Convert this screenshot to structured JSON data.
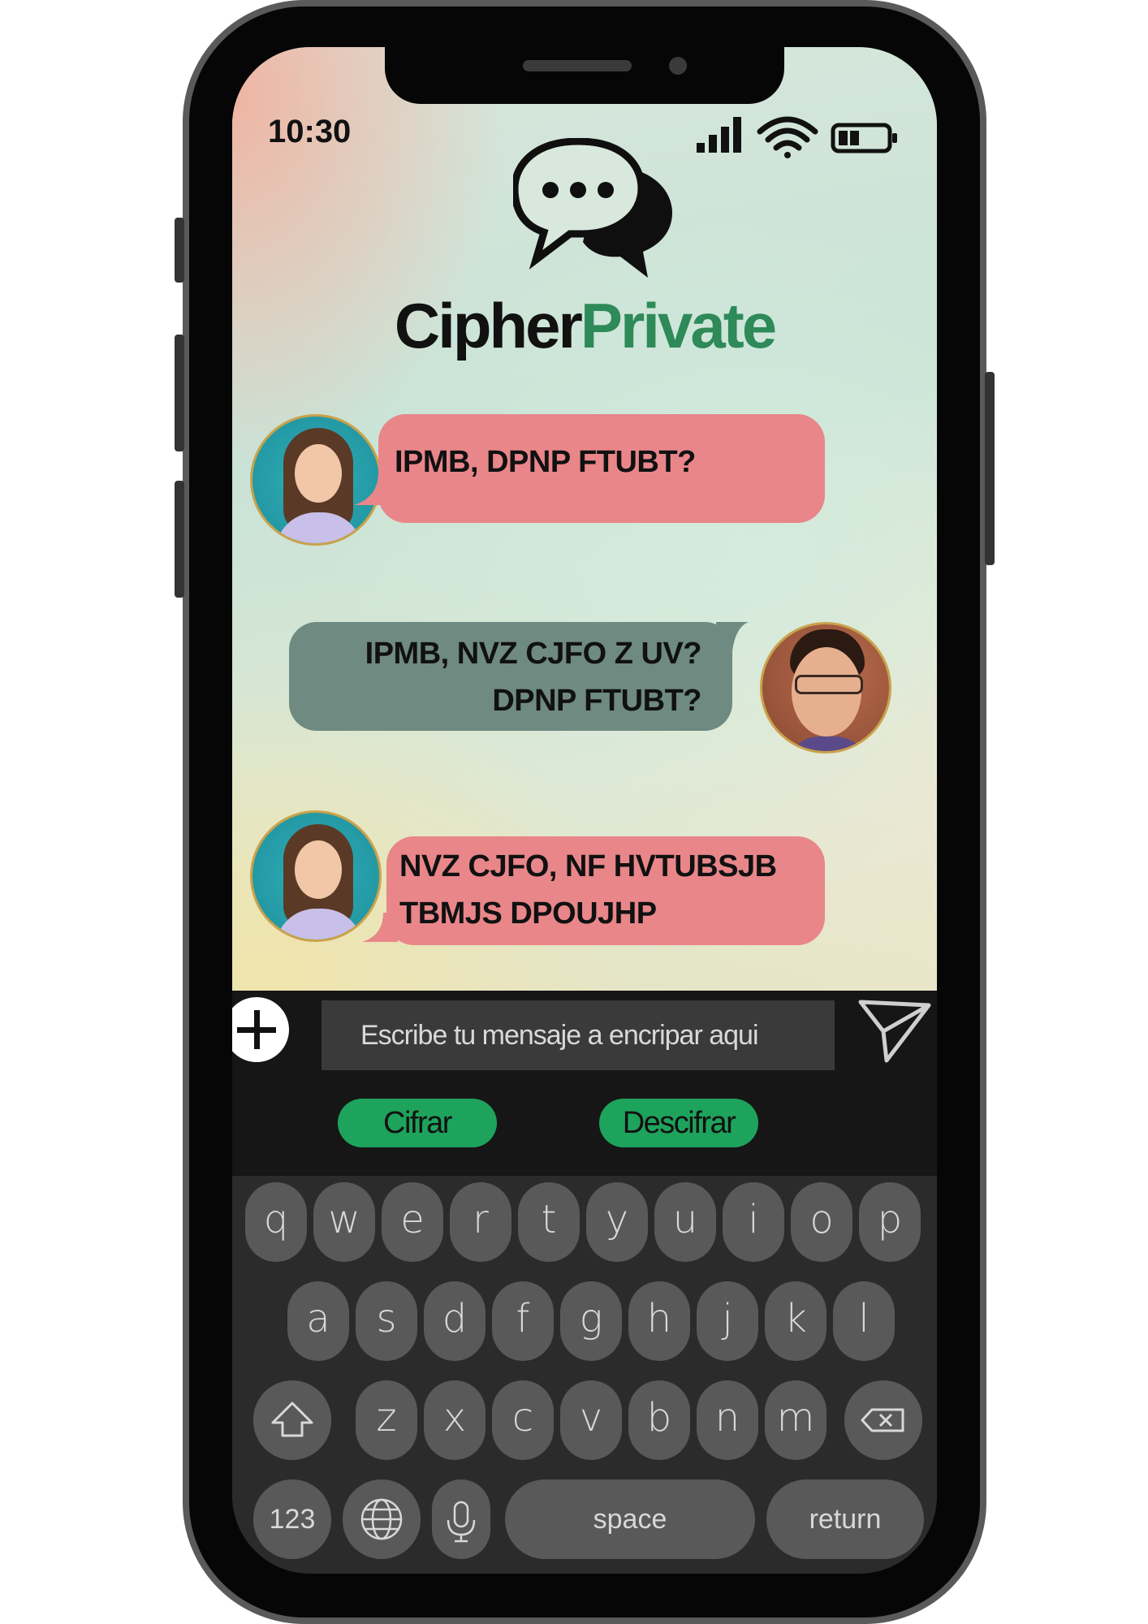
{
  "status_bar": {
    "time": "10:30"
  },
  "app": {
    "name_part1": "Cipher",
    "name_part2": "Private"
  },
  "colors": {
    "brand_green": "#2e8a58",
    "bubble_pink": "#e8868a",
    "bubble_gray": "#6f8a80",
    "button_green": "#1ea35c"
  },
  "messages": [
    {
      "sender": "girl",
      "lines": [
        "IPMB, DPNP FTUBT?"
      ]
    },
    {
      "sender": "man",
      "lines": [
        "IPMB, NVZ CJFO Z UV?",
        "DPNP FTUBT?"
      ]
    },
    {
      "sender": "girl",
      "lines": [
        "NVZ CJFO, NF HVTUBSJB",
        "TBMJS DPOUJHP"
      ]
    }
  ],
  "composer": {
    "placeholder": "Escribe tu mensaje a encripar aqui",
    "encrypt_label": "Cifrar",
    "decrypt_label": "Descifrar"
  },
  "keyboard": {
    "row1": [
      "q",
      "w",
      "e",
      "r",
      "t",
      "y",
      "u",
      "i",
      "o",
      "p"
    ],
    "row2": [
      "a",
      "s",
      "d",
      "f",
      "g",
      "h",
      "j",
      "k",
      "l"
    ],
    "row3": [
      "z",
      "x",
      "c",
      "v",
      "b",
      "n",
      "m"
    ],
    "numbers_label": "123",
    "space_label": "space",
    "return_label": "return"
  }
}
